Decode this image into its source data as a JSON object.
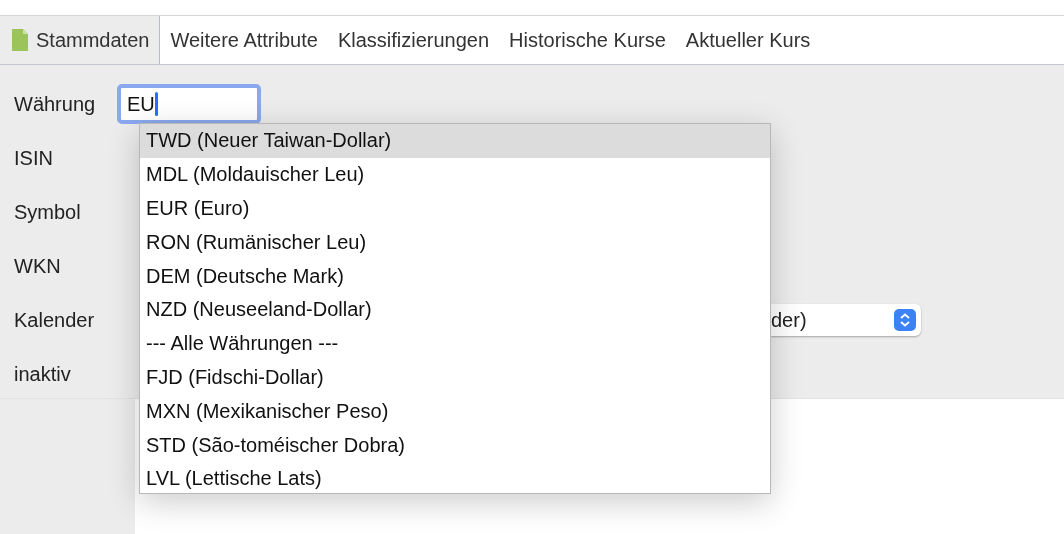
{
  "tabs": [
    {
      "label": "Stammdaten",
      "selected": true,
      "kind": "document"
    },
    {
      "label": "Weitere Attribute",
      "selected": false
    },
    {
      "label": "Klassifizierungen",
      "selected": false
    },
    {
      "label": "Historische Kurse",
      "selected": false
    },
    {
      "label": "Aktueller Kurs",
      "selected": false
    }
  ],
  "form": {
    "fields": [
      {
        "label": "Währung",
        "kind": "text",
        "value": "EU",
        "focused": true
      },
      {
        "label": "ISIN",
        "kind": "hidden"
      },
      {
        "label": "Symbol",
        "kind": "hidden"
      },
      {
        "label": "WKN",
        "kind": "hidden"
      },
      {
        "label": "Kalender",
        "kind": "select",
        "value": "der)"
      },
      {
        "label": "inaktiv",
        "kind": "hidden"
      }
    ]
  },
  "suggestions": [
    {
      "label": "TWD (Neuer Taiwan-Dollar)",
      "selected": true
    },
    {
      "label": "MDL (Moldauischer Leu)",
      "selected": false
    },
    {
      "label": "EUR (Euro)",
      "selected": false
    },
    {
      "label": "RON (Rumänischer Leu)",
      "selected": false
    },
    {
      "label": "DEM (Deutsche Mark)",
      "selected": false
    },
    {
      "label": "NZD (Neuseeland-Dollar)",
      "selected": false
    },
    {
      "label": "--- Alle Währungen ---",
      "selected": false
    },
    {
      "label": "FJD (Fidschi-Dollar)",
      "selected": false
    },
    {
      "label": "MXN (Mexikanischer Peso)",
      "selected": false
    },
    {
      "label": "STD (São-toméischer Dobra)",
      "selected": false
    },
    {
      "label": "LVL (Lettische Lats)",
      "selected": false
    }
  ]
}
